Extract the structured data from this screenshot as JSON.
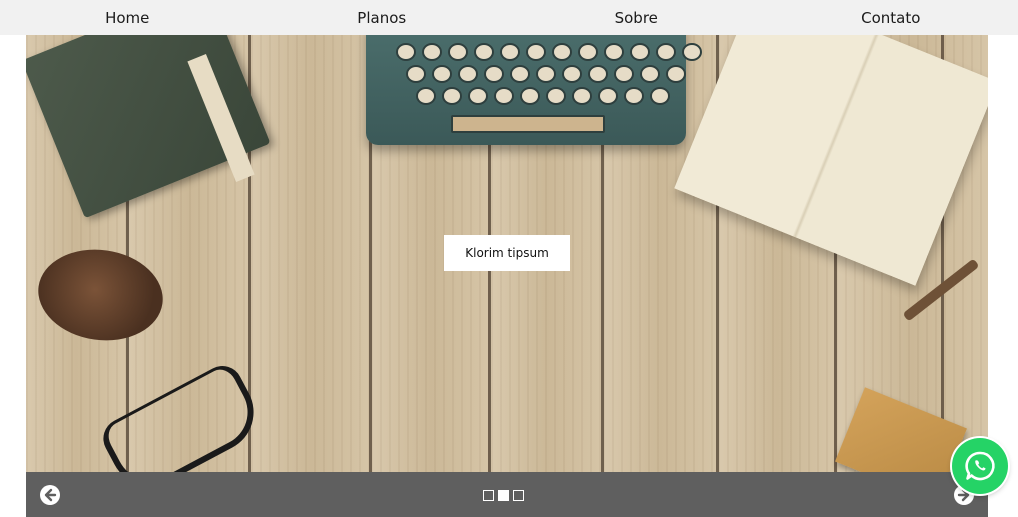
{
  "nav": {
    "items": [
      {
        "label": "Home"
      },
      {
        "label": "Planos"
      },
      {
        "label": "Sobre"
      },
      {
        "label": "Contato"
      }
    ]
  },
  "hero": {
    "button_label": "Klorim tipsum"
  },
  "slider": {
    "slides_count": 3,
    "active_slide": 2,
    "prev_icon": "arrow-left-icon",
    "next_icon": "arrow-right-icon"
  },
  "whatsapp": {
    "icon": "whatsapp-icon",
    "color": "#25d366"
  },
  "colors": {
    "nav_bg": "#f1f1f1",
    "control_bar_bg": "#5f5f5f"
  }
}
